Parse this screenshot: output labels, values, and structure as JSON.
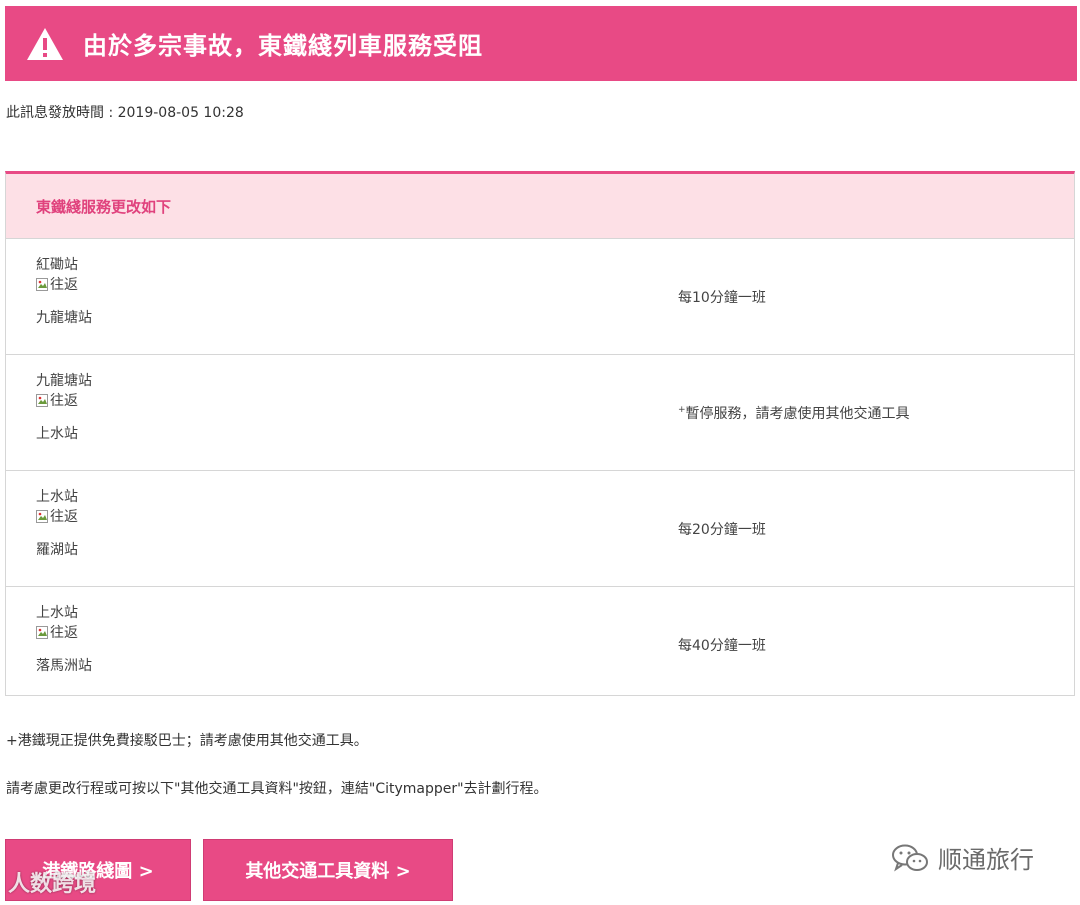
{
  "banner": {
    "title": "由於多宗事故，東鐵綫列車服務受阻",
    "icon": "warning-icon"
  },
  "issued_label": "此訊息發放時間 : 2019-08-05 10:28",
  "panel": {
    "heading": "東鐵綫服務更改如下",
    "rows": [
      {
        "from": "紅磡站",
        "img_alt": "往返",
        "to": "九龍塘站",
        "freq": "每10分鐘一班",
        "sup": ""
      },
      {
        "from": "九龍塘站",
        "img_alt": "往返",
        "to": "上水站",
        "freq": "暫停服務，請考慮使用其他交通工具",
        "sup": "+"
      },
      {
        "from": "上水站",
        "img_alt": "往返",
        "to": "羅湖站",
        "freq": "每20分鐘一班",
        "sup": ""
      },
      {
        "from": "上水站",
        "img_alt": "往返",
        "to": "落馬洲站",
        "freq": "每40分鐘一班",
        "sup": ""
      }
    ]
  },
  "notes": {
    "note1": "+港鐵現正提供免費接駁巴士；請考慮使用其他交通工具。",
    "note2": "請考慮更改行程或可按以下\"其他交通工具資料\"按鈕，連結\"Citymapper\"去計劃行程。"
  },
  "buttons": {
    "route_map": "港鐵路綫圖 >",
    "other_transport": "其他交通工具資料 >"
  },
  "watermarks": {
    "right": "顺通旅行",
    "left": "人数跨境"
  },
  "colors": {
    "accent": "#e84a85",
    "panel_head_bg": "#fde0e6",
    "heading_text": "#e0427d"
  }
}
